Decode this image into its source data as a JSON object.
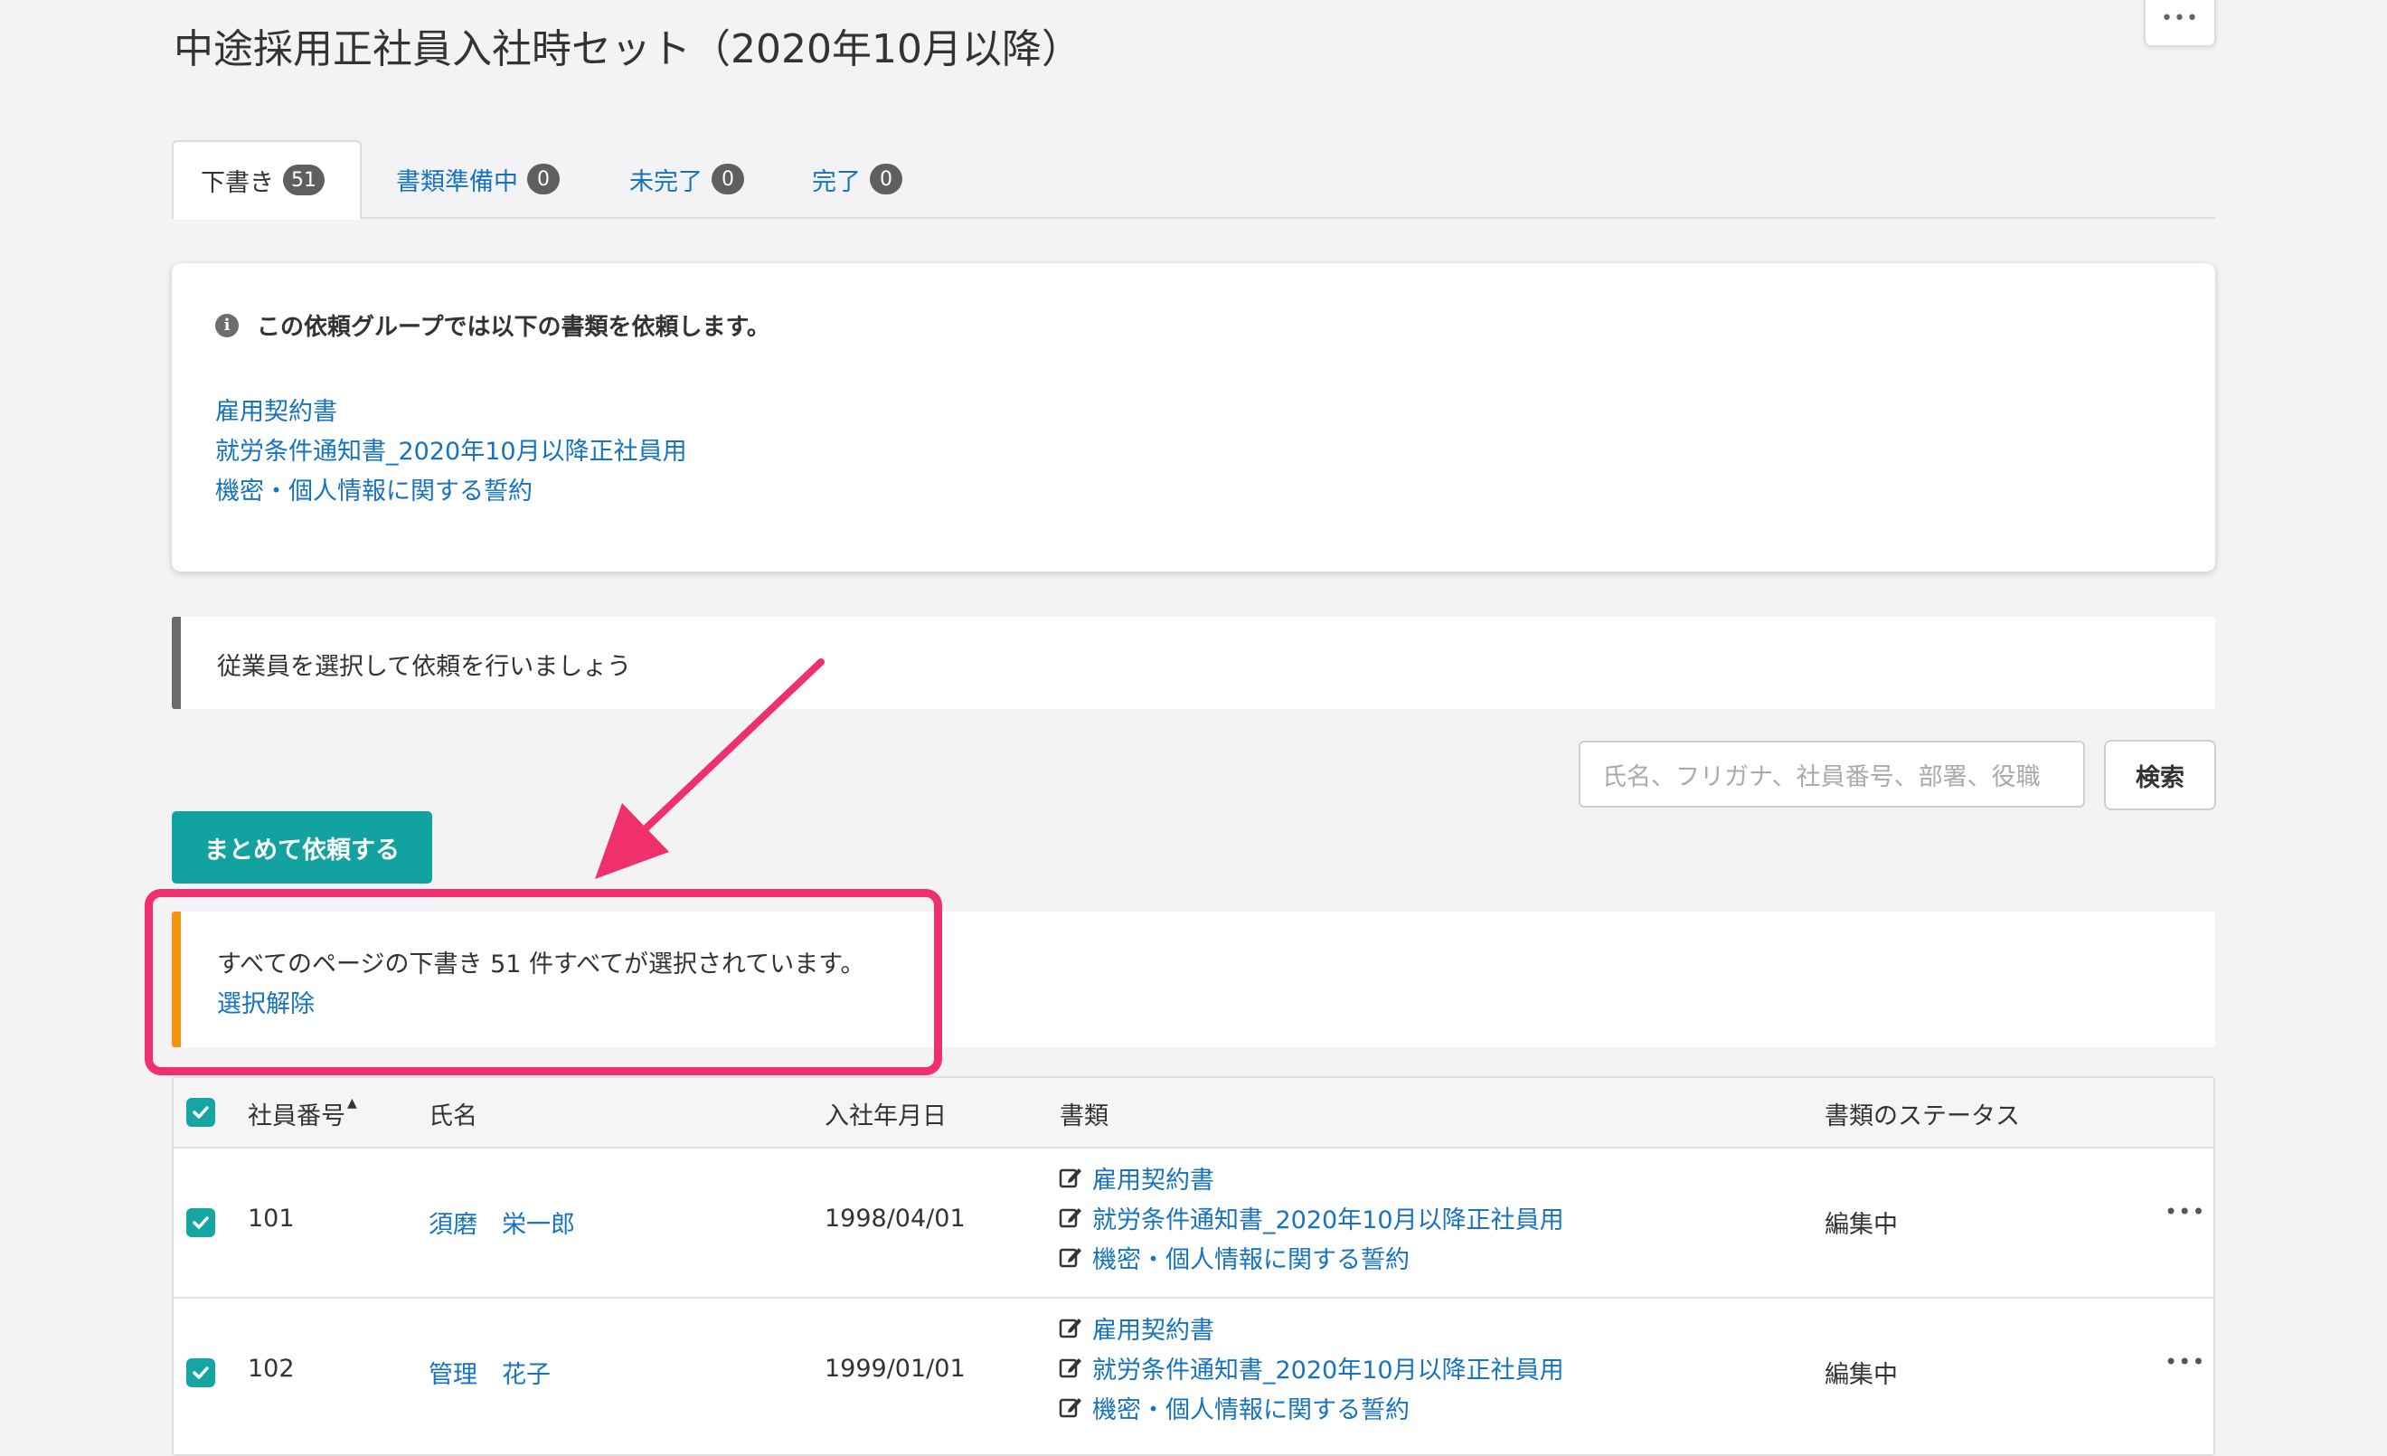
{
  "header": {
    "title": "中途採用正社員入社時セット（2020年10月以降）",
    "more_label": "•••"
  },
  "tabs": [
    {
      "label": "下書き",
      "count": "51"
    },
    {
      "label": "書類準備中",
      "count": "0"
    },
    {
      "label": "未完了",
      "count": "0"
    },
    {
      "label": "完了",
      "count": "0"
    }
  ],
  "info": {
    "icon": "i",
    "title": "この依頼グループでは以下の書類を依頼します。",
    "documents": [
      "雇用契約書",
      "就労条件通知書_2020年10月以降正社員用",
      "機密・個人情報に関する誓約"
    ]
  },
  "notice": {
    "text": "従業員を選択して依頼を行いましょう"
  },
  "search": {
    "placeholder": "氏名、フリガナ、社員番号、部署、役職",
    "button_label": "検索"
  },
  "bulk_button_label": "まとめて依頼する",
  "selection": {
    "text": "すべてのページの下書き 51 件すべてが選択されています。",
    "deselect_label": "選択解除"
  },
  "table": {
    "headers": {
      "employee_no": "社員番号",
      "sort_indicator": "▲",
      "name": "氏名",
      "hire_date": "入社年月日",
      "documents": "書類",
      "status": "書類のステータス"
    },
    "rows": [
      {
        "employee_no": "101",
        "name": "須磨　栄一郎",
        "hire_date": "1998/04/01",
        "documents": [
          "雇用契約書",
          "就労条件通知書_2020年10月以降正社員用",
          "機密・個人情報に関する誓約"
        ],
        "status": "編集中",
        "more": "•••"
      },
      {
        "employee_no": "102",
        "name": "管理　花子",
        "hire_date": "1999/01/01",
        "documents": [
          "雇用契約書",
          "就労条件通知書_2020年10月以降正社員用",
          "機密・個人情報に関する誓約"
        ],
        "status": "編集中",
        "more": "•••"
      }
    ]
  },
  "colors": {
    "link": "#1673c2",
    "teal": "#12a3a1",
    "highlight": "#f0306c",
    "notice_orange": "#f4930f"
  }
}
